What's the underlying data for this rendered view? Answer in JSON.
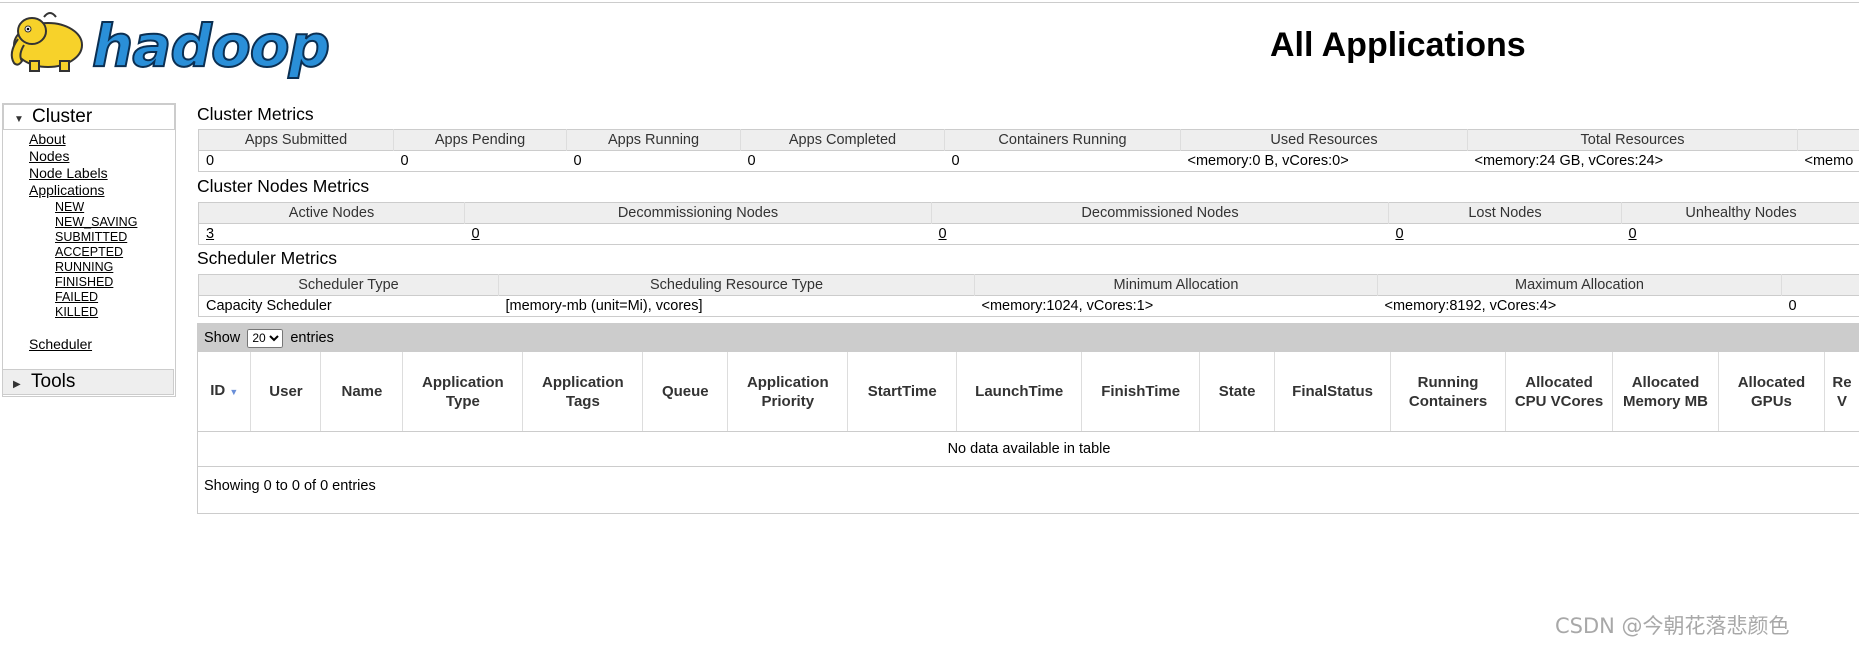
{
  "header": {
    "logo_text": "hadoop",
    "title": "All Applications"
  },
  "sidebar": {
    "cluster_label": "Cluster",
    "cluster_links": [
      "About",
      "Nodes",
      "Node Labels",
      "Applications"
    ],
    "app_states": [
      "NEW",
      "NEW_SAVING",
      "SUBMITTED",
      "ACCEPTED",
      "RUNNING",
      "FINISHED",
      "FAILED",
      "KILLED"
    ],
    "scheduler_label": "Scheduler",
    "tools_label": "Tools"
  },
  "cluster_metrics": {
    "title": "Cluster Metrics",
    "headers": [
      "Apps Submitted",
      "Apps Pending",
      "Apps Running",
      "Apps Completed",
      "Containers Running",
      "Used Resources",
      "Total Resources",
      ""
    ],
    "values": [
      "0",
      "0",
      "0",
      "0",
      "0",
      "<memory:0 B, vCores:0>",
      "<memory:24 GB, vCores:24>",
      "<memo"
    ]
  },
  "node_metrics": {
    "title": "Cluster Nodes Metrics",
    "headers": [
      "Active Nodes",
      "Decommissioning Nodes",
      "Decommissioned Nodes",
      "Lost Nodes",
      "Unhealthy Nodes"
    ],
    "values": [
      "3",
      "0",
      "0",
      "0",
      "0"
    ]
  },
  "scheduler_metrics": {
    "title": "Scheduler Metrics",
    "headers": [
      "Scheduler Type",
      "Scheduling Resource Type",
      "Minimum Allocation",
      "Maximum Allocation",
      ""
    ],
    "values": [
      "Capacity Scheduler",
      "[memory-mb (unit=Mi), vcores]",
      "<memory:1024, vCores:1>",
      "<memory:8192, vCores:4>",
      "0"
    ]
  },
  "apps_table": {
    "show_label": "Show",
    "page_size": "20",
    "entries_label": "entries",
    "columns": [
      "ID",
      "User",
      "Name",
      "Application Type",
      "Application Tags",
      "Queue",
      "Application Priority",
      "StartTime",
      "LaunchTime",
      "FinishTime",
      "State",
      "FinalStatus",
      "Running Containers",
      "Allocated CPU VCores",
      "Allocated Memory MB",
      "Allocated GPUs",
      "Re V"
    ],
    "empty_text": "No data available in table",
    "info_text": "Showing 0 to 0 of 0 entries"
  },
  "watermark": "CSDN @今朝花落悲颜色"
}
